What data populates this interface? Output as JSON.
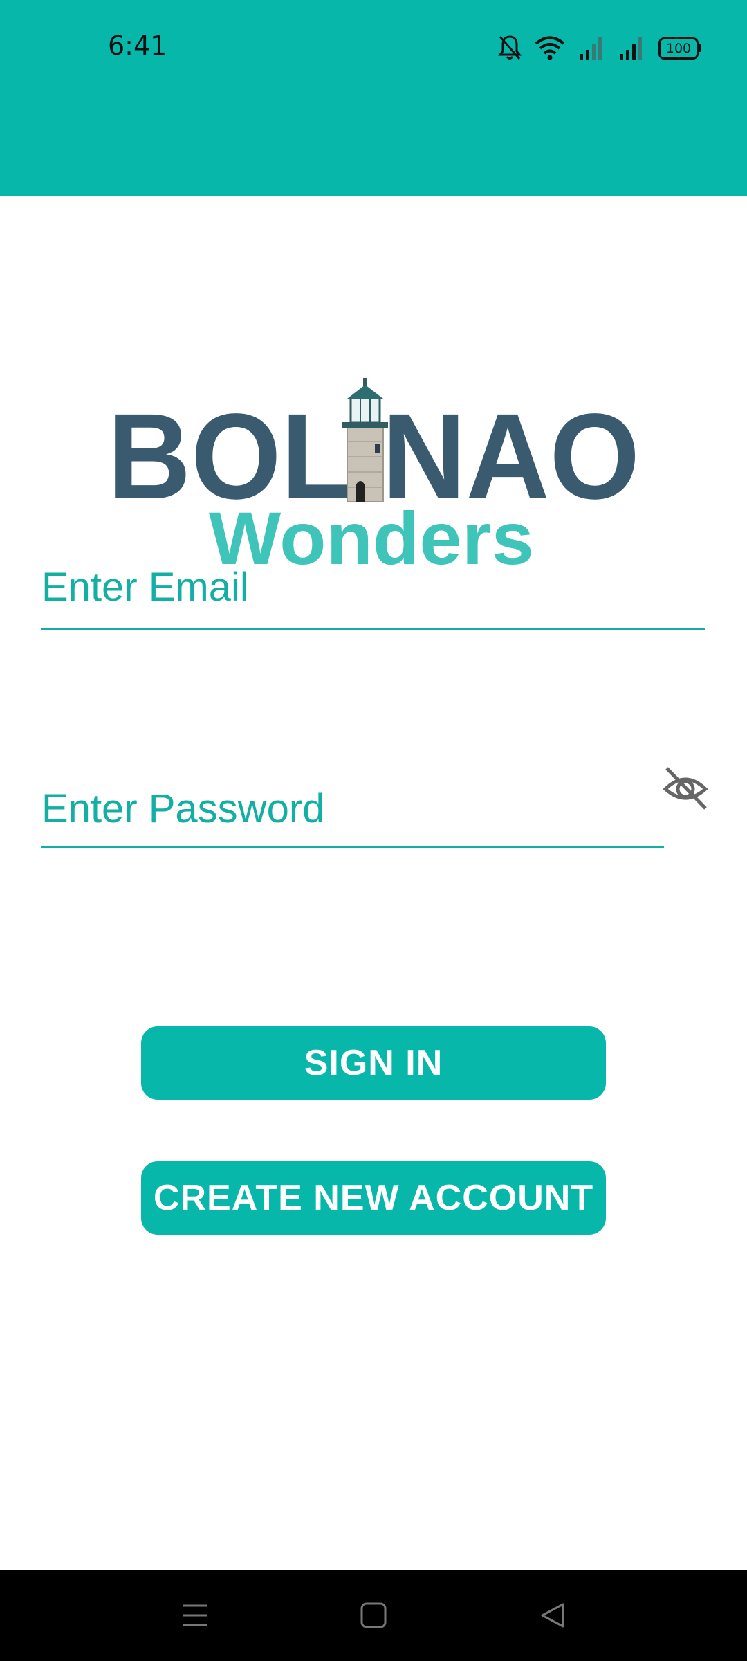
{
  "status_bar": {
    "time": "6:41",
    "battery": "100",
    "icons": [
      "bell-off-icon",
      "wifi-icon",
      "signal-icon",
      "signal-icon",
      "battery-icon"
    ]
  },
  "logo": {
    "line1": "BOLINAO",
    "line2": "Wonders"
  },
  "form": {
    "email_placeholder": "Enter Email",
    "password_placeholder": "Enter Password",
    "password_toggle_icon": "eye-off-icon"
  },
  "buttons": {
    "sign_in": "SIGN IN",
    "create_account": "CREATE NEW ACCOUNT"
  },
  "nav": {
    "icons": [
      "menu-icon",
      "home-square-icon",
      "back-triangle-icon"
    ]
  },
  "colors": {
    "accent": "#07B8AA",
    "logo_dark": "#3A5A70",
    "logo_teal": "#3EC4B8"
  }
}
